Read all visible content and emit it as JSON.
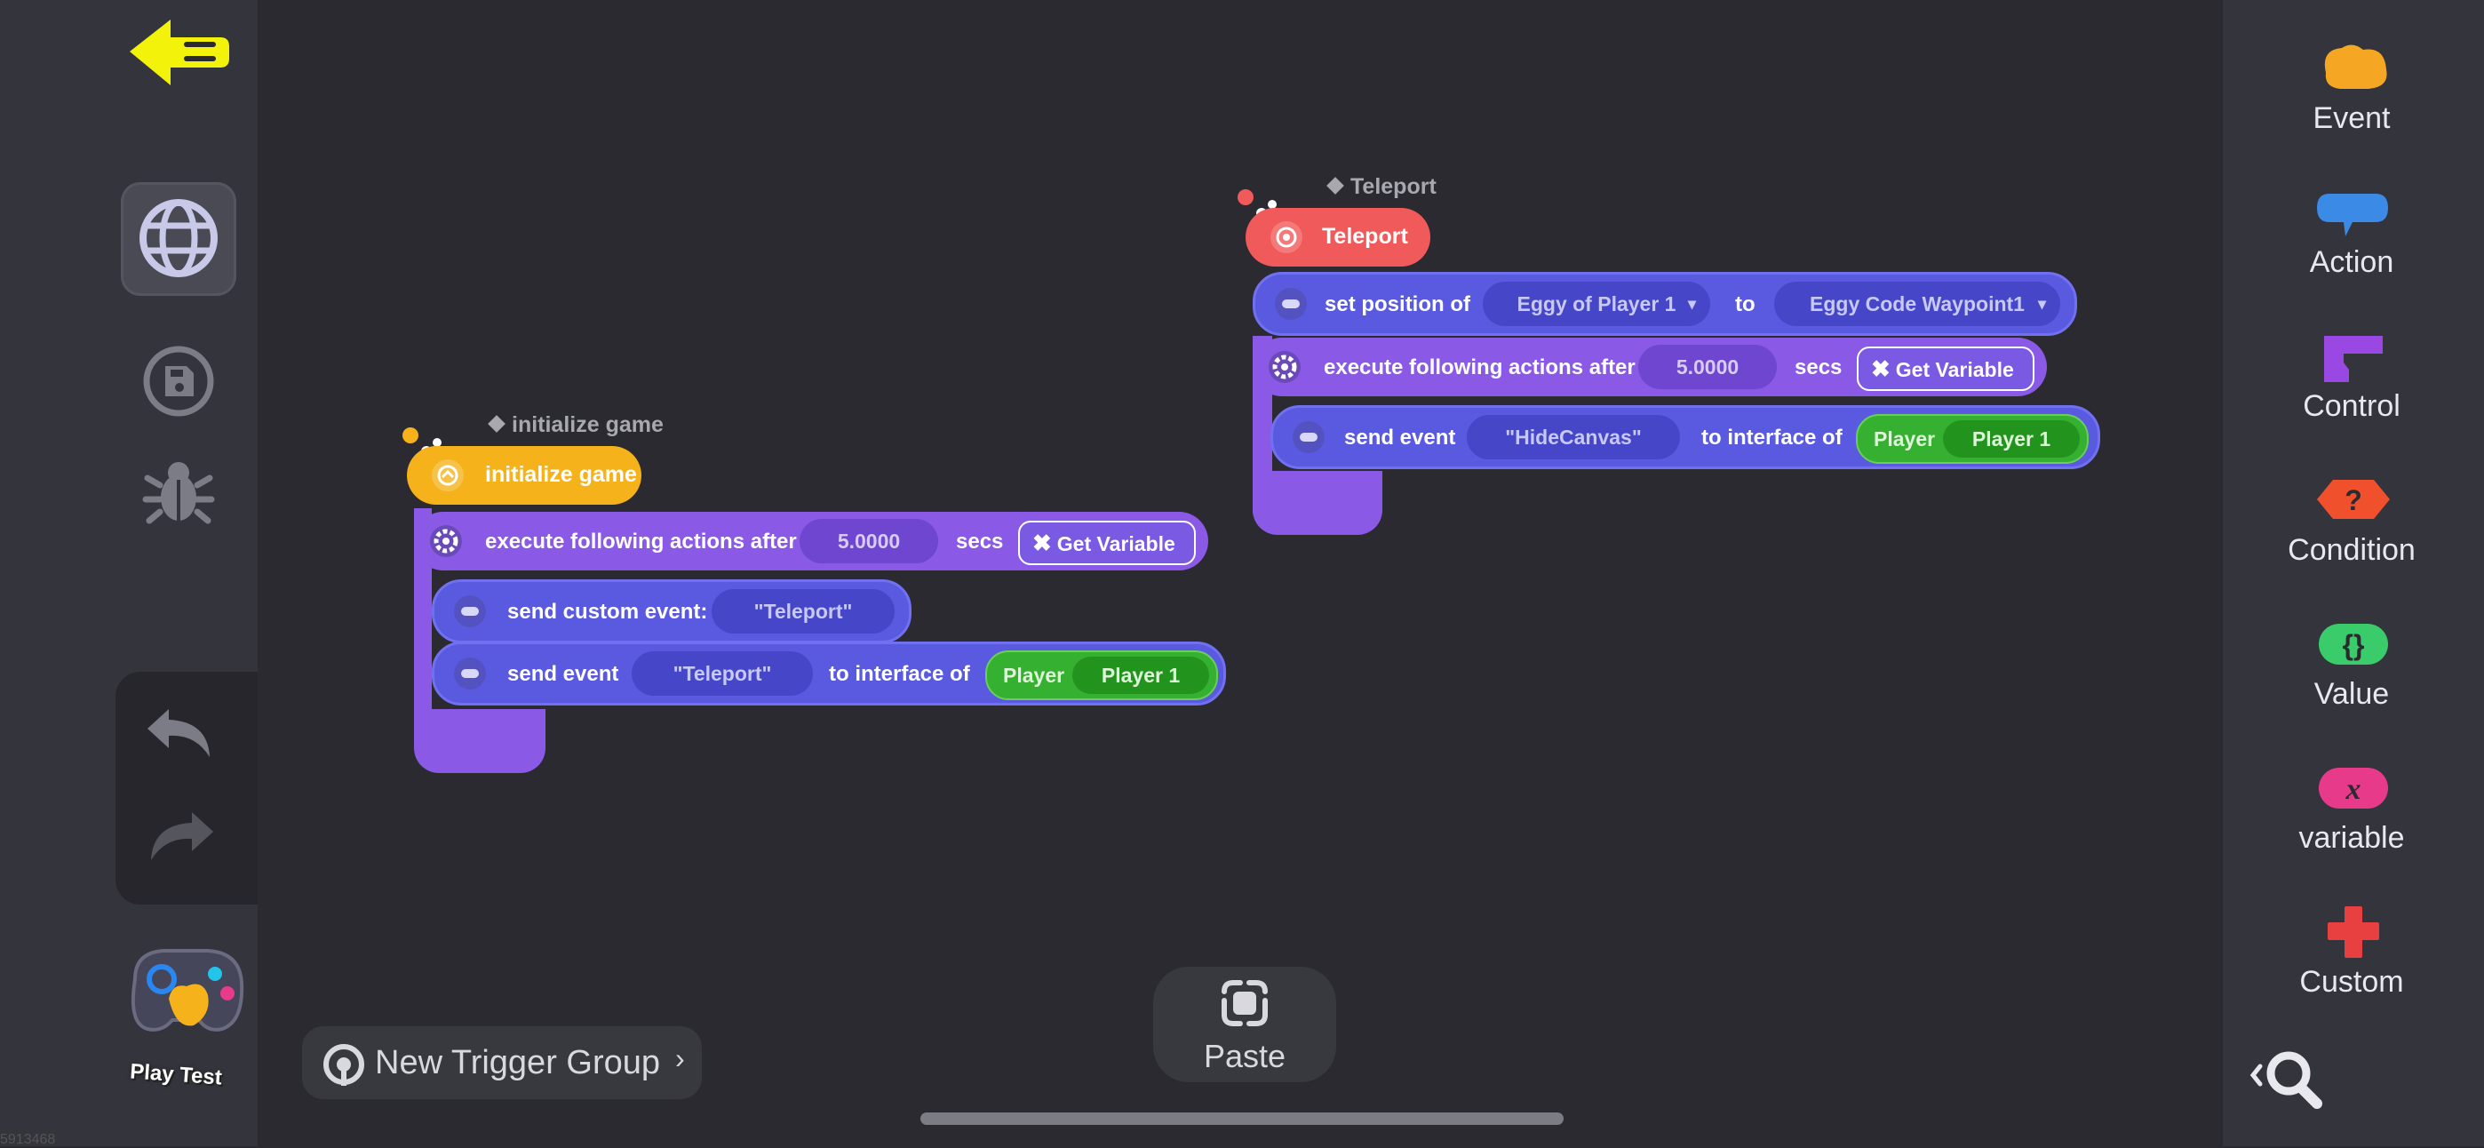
{
  "left_sidebar": {
    "icons": [
      "back-arrow-icon",
      "globe-icon",
      "save-icon",
      "bug-icon",
      "undo-icon",
      "redo-icon",
      "gamepad-icon"
    ],
    "play_test_label": "Play Test",
    "bottom_text": "5913468"
  },
  "right_sidebar": {
    "categories": [
      {
        "label": "Event",
        "icon": "event-blob-icon",
        "color": "#f5a623"
      },
      {
        "label": "Action",
        "icon": "action-bubble-icon",
        "color": "#3a8ae6"
      },
      {
        "label": "Control",
        "icon": "control-bracket-icon",
        "color": "#9a48e4"
      },
      {
        "label": "Condition",
        "icon": "condition-question-icon",
        "color": "#f0502c"
      },
      {
        "label": "Value",
        "icon": "value-braces-icon",
        "color": "#3acb6a"
      },
      {
        "label": "variable",
        "icon": "variable-x-icon",
        "color": "#e83a8a"
      },
      {
        "label": "Custom",
        "icon": "custom-plus-icon",
        "color": "#e84040"
      }
    ],
    "search_icon": "zoom-search-icon"
  },
  "bottom_bar": {
    "trigger_group_label": "New Trigger Group",
    "paste_label": "Paste"
  },
  "block_group_1": {
    "title": "initialize game",
    "hat_label": "initialize game",
    "hat_color": "#f5b21a",
    "row1": {
      "text": "execute following actions after",
      "value": "5.0000",
      "unit": "secs",
      "var_label": "Get Variable"
    },
    "row2": {
      "text": "send custom event:",
      "value": "\"Teleport\""
    },
    "row3": {
      "text": "send event",
      "value": "\"Teleport\"",
      "text2": "to interface of",
      "player_label": "Player",
      "player_value": "Player 1"
    }
  },
  "block_group_2": {
    "title": "Teleport",
    "hat_label": "Teleport",
    "hat_color": "#f05a5a",
    "row1": {
      "text": "set position of",
      "value": "Eggy of Player 1",
      "text2": "to",
      "value2": "Eggy Code Waypoint1"
    },
    "row2": {
      "text": "execute following actions after",
      "value": "5.0000",
      "unit": "secs",
      "var_label": "Get Variable"
    },
    "row3": {
      "text": "send event",
      "value": "\"HideCanvas\"",
      "text2": "to interface of",
      "player_label": "Player",
      "player_value": "Player 1"
    }
  }
}
